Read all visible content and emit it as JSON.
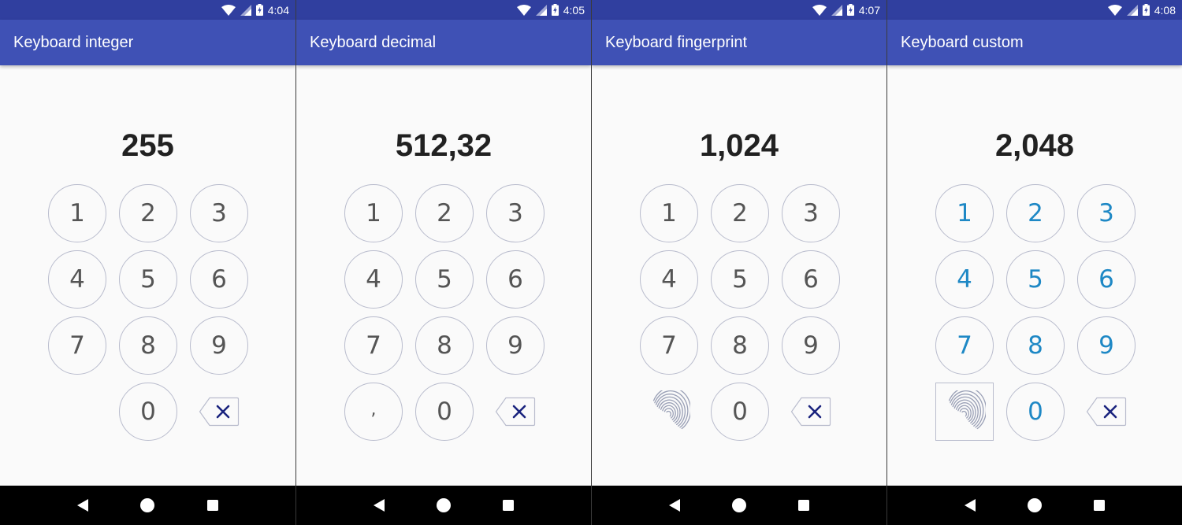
{
  "colors": {
    "status_bar": "#303f9f",
    "app_bar": "#3f51b5",
    "key_border": "#b9bccd",
    "key_text": "#555555",
    "custom_key_text": "#1e88c5",
    "display_text": "#212121"
  },
  "screens": [
    {
      "time": "4:04",
      "title": "Keyboard integer",
      "display": "255",
      "keys": [
        {
          "label": "1",
          "kind": "digit"
        },
        {
          "label": "2",
          "kind": "digit"
        },
        {
          "label": "3",
          "kind": "digit"
        },
        {
          "label": "4",
          "kind": "digit"
        },
        {
          "label": "5",
          "kind": "digit"
        },
        {
          "label": "6",
          "kind": "digit"
        },
        {
          "label": "7",
          "kind": "digit"
        },
        {
          "label": "8",
          "kind": "digit"
        },
        {
          "label": "9",
          "kind": "digit"
        },
        {
          "label": "",
          "kind": "empty"
        },
        {
          "label": "0",
          "kind": "digit"
        },
        {
          "label": "",
          "kind": "backspace"
        }
      ],
      "style": "default"
    },
    {
      "time": "4:05",
      "title": "Keyboard decimal",
      "display": "512,32",
      "keys": [
        {
          "label": "1",
          "kind": "digit"
        },
        {
          "label": "2",
          "kind": "digit"
        },
        {
          "label": "3",
          "kind": "digit"
        },
        {
          "label": "4",
          "kind": "digit"
        },
        {
          "label": "5",
          "kind": "digit"
        },
        {
          "label": "6",
          "kind": "digit"
        },
        {
          "label": "7",
          "kind": "digit"
        },
        {
          "label": "8",
          "kind": "digit"
        },
        {
          "label": "9",
          "kind": "digit"
        },
        {
          "label": ",",
          "kind": "decimal"
        },
        {
          "label": "0",
          "kind": "digit"
        },
        {
          "label": "",
          "kind": "backspace"
        }
      ],
      "style": "default"
    },
    {
      "time": "4:07",
      "title": "Keyboard fingerprint",
      "display": "1,024",
      "keys": [
        {
          "label": "1",
          "kind": "digit"
        },
        {
          "label": "2",
          "kind": "digit"
        },
        {
          "label": "3",
          "kind": "digit"
        },
        {
          "label": "4",
          "kind": "digit"
        },
        {
          "label": "5",
          "kind": "digit"
        },
        {
          "label": "6",
          "kind": "digit"
        },
        {
          "label": "7",
          "kind": "digit"
        },
        {
          "label": "8",
          "kind": "digit"
        },
        {
          "label": "9",
          "kind": "digit"
        },
        {
          "label": "",
          "kind": "fingerprint"
        },
        {
          "label": "0",
          "kind": "digit"
        },
        {
          "label": "",
          "kind": "backspace"
        }
      ],
      "style": "default"
    },
    {
      "time": "4:08",
      "title": "Keyboard custom",
      "display": "2,048",
      "keys": [
        {
          "label": "1",
          "kind": "digit"
        },
        {
          "label": "2",
          "kind": "digit"
        },
        {
          "label": "3",
          "kind": "digit"
        },
        {
          "label": "4",
          "kind": "digit"
        },
        {
          "label": "5",
          "kind": "digit"
        },
        {
          "label": "6",
          "kind": "digit"
        },
        {
          "label": "7",
          "kind": "digit"
        },
        {
          "label": "8",
          "kind": "digit"
        },
        {
          "label": "9",
          "kind": "digit"
        },
        {
          "label": "",
          "kind": "fingerprint-square"
        },
        {
          "label": "0",
          "kind": "digit"
        },
        {
          "label": "",
          "kind": "backspace"
        }
      ],
      "style": "custom"
    }
  ],
  "navigation": {
    "icons": [
      "back-icon",
      "home-icon",
      "recents-icon"
    ]
  },
  "status_icons": [
    "wifi-icon",
    "signal-icon",
    "battery-charging-icon"
  ]
}
